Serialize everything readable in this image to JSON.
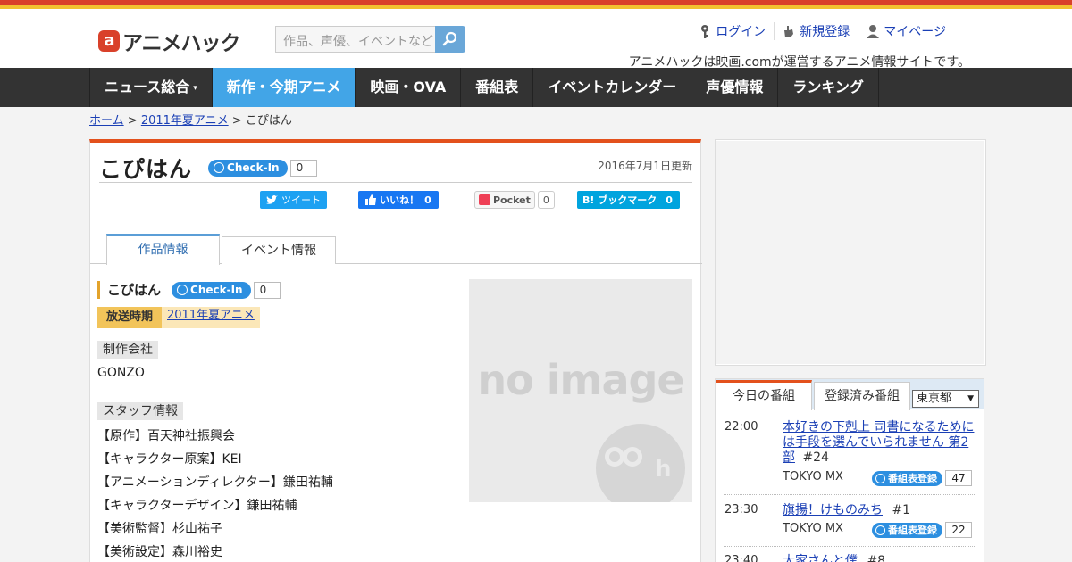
{
  "header": {
    "logo_mark": "a",
    "logo_text": "アニメハック",
    "search_placeholder": "作品、声優、イベントなど",
    "links": [
      {
        "label": "ログイン",
        "icon": "key-icon"
      },
      {
        "label": "新規登録",
        "icon": "hand-icon"
      },
      {
        "label": "マイページ",
        "icon": "user-icon"
      }
    ],
    "tagline": "アニメハックは映画.comが運営するアニメ情報サイトです。"
  },
  "nav": {
    "items": [
      {
        "label": "ニュース総合",
        "caret": "▾"
      },
      {
        "label": "新作・今期アニメ",
        "active": true
      },
      {
        "label": "映画・OVA"
      },
      {
        "label": "番組表"
      },
      {
        "label": "イベントカレンダー"
      },
      {
        "label": "声優情報"
      },
      {
        "label": "ランキング"
      }
    ]
  },
  "breadcrumb": {
    "home": "ホーム",
    "sep1": ">",
    "season": "2011年夏アニメ",
    "sep2": ">",
    "current": "こぴはん"
  },
  "main": {
    "title": "こぴはん",
    "checkin_label": "Check-In",
    "checkin_count": "0",
    "updated": "2016年7月1日更新",
    "share": {
      "tweet": "ツイート",
      "like": "いいね！",
      "like_count": "0",
      "pocket": "Pocket",
      "pocket_count": "0",
      "hatena": "B! ブックマーク",
      "hatena_count": "0"
    },
    "tabs": [
      {
        "label": "作品情報",
        "active": true
      },
      {
        "label": "イベント情報"
      }
    ],
    "work": {
      "name": "こぴはん",
      "checkin_label": "Check-In",
      "checkin_count": "0",
      "period_label": "放送時期",
      "period_value": "2011年夏アニメ",
      "studio_label": "制作会社",
      "studio": "GONZO",
      "staff_label": "スタッフ情報",
      "staff": [
        "【原作】百天神社振興会",
        "【キャラクター原案】KEI",
        "【アニメーションディレクター】鎌田祐輔",
        "【キャラクターデザイン】鎌田祐輔",
        "【美術監督】杉山祐子",
        "【美術設定】森川裕史"
      ],
      "no_image_text": "no image",
      "no_image_mark": "h"
    }
  },
  "sidebar": {
    "tabs": [
      {
        "label": "今日の番組",
        "active": true
      },
      {
        "label": "登録済み番組"
      }
    ],
    "region": "東京都",
    "register_label": "番組表登録",
    "programs": [
      {
        "time": "22:00",
        "title": "本好きの下剋上 司書になるためには手段を選んでいられません 第2部",
        "episode": "#24",
        "channel": "TOKYO MX",
        "count": "47"
      },
      {
        "time": "23:30",
        "title": "旗揚！けものみち",
        "episode": "#1",
        "channel": "TOKYO MX",
        "count": "22"
      },
      {
        "time": "23:40",
        "title": "大家さんと僕",
        "episode": "#8",
        "channel": "",
        "count": ""
      }
    ]
  }
}
